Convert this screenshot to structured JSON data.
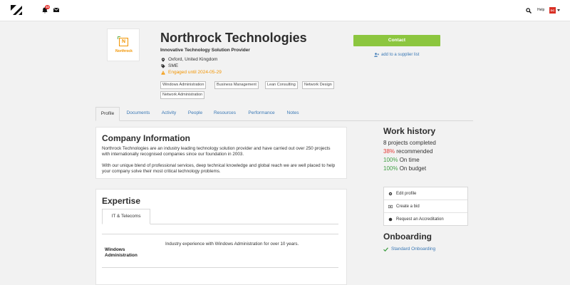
{
  "topbar": {
    "notification_count": "10",
    "help_label": "Help",
    "avatar_initials": "DC"
  },
  "company": {
    "logo_letter": "N",
    "logo_text": "Northrock",
    "name": "Northrock Technologies",
    "tagline": "Innovative Technology Solution Provider",
    "location": "Oxford, United Kingdom",
    "size": "SME",
    "engaged": "Engaged until 2024-05-29",
    "tags": [
      "Windows Administration",
      "Business Management",
      "Lean Consulting",
      "Network Design",
      "Network Administration"
    ],
    "contact_label": "Contact",
    "supplier_list_label": "add to a supplier list"
  },
  "tabs": [
    "Profile",
    "Documents",
    "Activity",
    "People",
    "Resources",
    "Performance",
    "Notes"
  ],
  "company_info": {
    "title": "Company Information",
    "paragraph_1": "Northrock Technologies are an industry leading technology solution provider and have carried out over 250 projects with internationally recognised companies since our foundation in 2003.",
    "paragraph_2": "With our unique blend of professional services, deep technical knowledge and global reach we are well placed to help your company solve their most critical technology problems."
  },
  "expertise": {
    "title": "Expertise",
    "tab": "IT & Telecoms",
    "skill": "Windows Administration",
    "description": "Industry experience with Windows Administration for over 10 years."
  },
  "work_history": {
    "title": "Work history",
    "projects_completed": "8 projects completed",
    "recommended_pct": "38%",
    "recommended_label": "recommended",
    "on_time_pct": "100%",
    "on_time_label": "On time",
    "on_budget_pct": "100%",
    "on_budget_label": "On budget"
  },
  "actions": [
    "Edit profile",
    "Create a bid",
    "Request an Accreditation"
  ],
  "onboarding": {
    "title": "Onboarding",
    "item": "Standard Onboarding"
  },
  "colors": {
    "accent_green": "#8cc63f",
    "link_blue": "#3a78b5",
    "warning_orange": "#f29400",
    "danger_red": "#e53935",
    "success_green": "#43a047"
  }
}
